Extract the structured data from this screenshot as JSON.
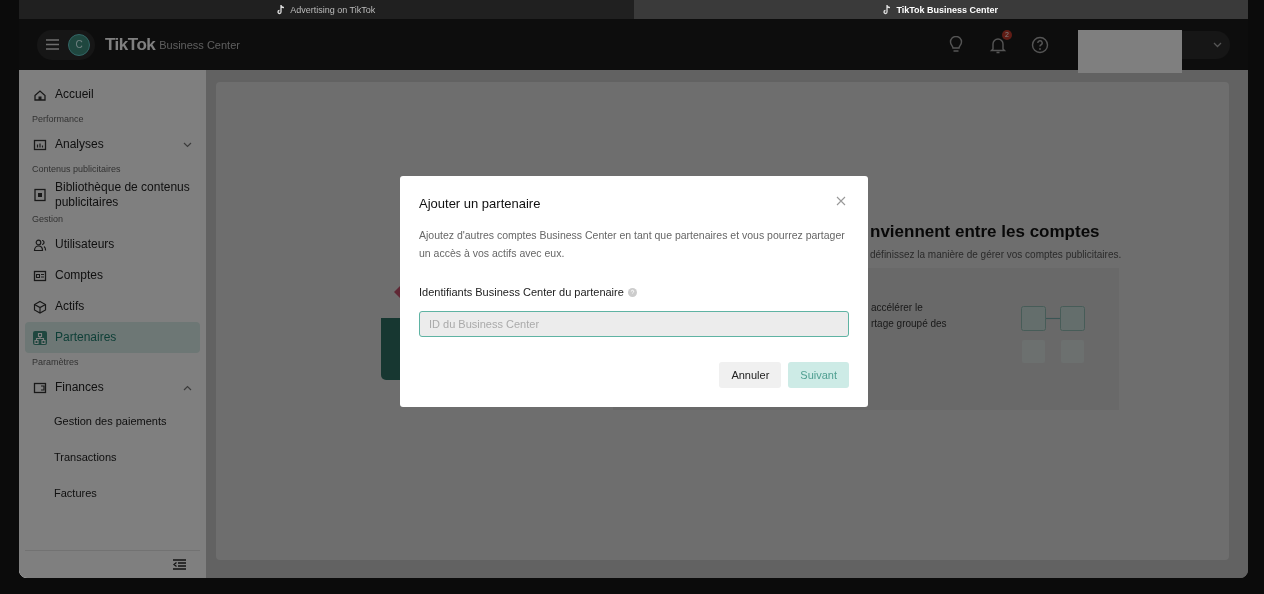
{
  "browser_tabs": [
    {
      "label": "Advertising on TikTok",
      "selected": false
    },
    {
      "label": "TikTok Business Center",
      "selected": true
    }
  ],
  "header": {
    "avatar_initial": "C",
    "logo": "TikTok",
    "product": "Business Center",
    "notification_count": "2"
  },
  "sidebar": {
    "items": [
      {
        "kind": "item",
        "label": "Accueil",
        "selected": false
      },
      {
        "kind": "section",
        "label": "Performance"
      },
      {
        "kind": "group",
        "label": "Analyses",
        "expanded": false,
        "selected": false
      },
      {
        "kind": "section",
        "label": "Contenus publicitaires"
      },
      {
        "kind": "item",
        "label": "Bibliothèque de contenus publicitaires",
        "selected": false
      },
      {
        "kind": "section",
        "label": "Gestion"
      },
      {
        "kind": "item",
        "label": "Utilisateurs",
        "selected": false
      },
      {
        "kind": "item",
        "label": "Comptes",
        "selected": false
      },
      {
        "kind": "item",
        "label": "Actifs",
        "selected": false
      },
      {
        "kind": "item",
        "label": "Partenaires",
        "selected": true
      },
      {
        "kind": "section",
        "label": "Paramètres"
      },
      {
        "kind": "group",
        "label": "Finances",
        "expanded": true,
        "selected": false,
        "children": [
          {
            "label": "Gestion des paiements",
            "selected": false
          },
          {
            "label": "Transactions",
            "selected": false
          },
          {
            "label": "Factures",
            "selected": false
          }
        ]
      }
    ]
  },
  "background": {
    "headline": "nviennent entre les comptes",
    "subtitle": "définissez la manière de gérer vos comptes publicitaires.",
    "panel_lines": [
      "accélérer le",
      "rtage groupé des"
    ]
  },
  "modal": {
    "title": "Ajouter un partenaire",
    "description": "Ajoutez d'autres comptes Business Center en tant que partenaires et vous pourrez partager un accès à vos actifs avec eux.",
    "field_label": "Identifiants Business Center du partenaire",
    "placeholder": "ID du Business Center",
    "buttons": [
      {
        "label": "Annuler",
        "kind": "secondary",
        "disabled": false
      },
      {
        "label": "Suivant",
        "kind": "primary",
        "disabled": true
      }
    ]
  }
}
